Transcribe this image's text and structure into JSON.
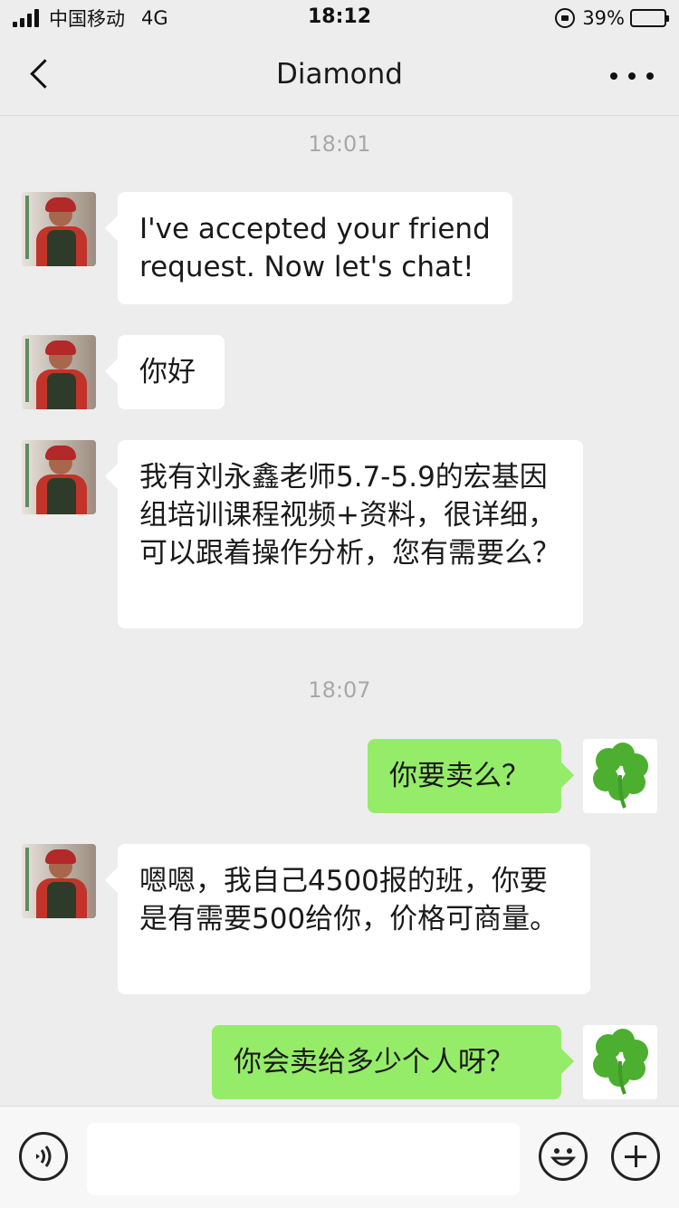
{
  "status_bar": {
    "carrier": "中国移动",
    "network": "4G",
    "time": "18:12",
    "battery": "39%",
    "battery_level": 0.39
  },
  "nav": {
    "title": "Diamond",
    "back_icon": "chevron-left-icon",
    "more_icon": "more-dots-icon"
  },
  "chat": {
    "timestamps": [
      "18:01",
      "18:07"
    ],
    "messages": [
      {
        "side": "left",
        "text": "I've accepted your friend request. Now let's chat!"
      },
      {
        "side": "left",
        "text": "你好"
      },
      {
        "side": "left",
        "text": "我有刘永鑫老师5.7-5.9的宏基因组培训课程视频+资料，很详细，可以跟着操作分析，您有需要么？"
      },
      {
        "side": "right",
        "text": "你要卖么？"
      },
      {
        "side": "left",
        "text": "嗯嗯，我自己4500报的班，你要是有需要500给你，价格可商量。"
      },
      {
        "side": "right",
        "text": "你会卖给多少个人呀？"
      }
    ]
  },
  "input_bar": {
    "voice_icon": "voice-icon",
    "emoji_icon": "emoji-icon",
    "plus_icon": "plus-icon",
    "input_value": ""
  },
  "colors": {
    "background": "#ededed",
    "bubble_self": "#95ec69",
    "bubble_other": "#ffffff",
    "timestamp": "#a8a8a8"
  }
}
